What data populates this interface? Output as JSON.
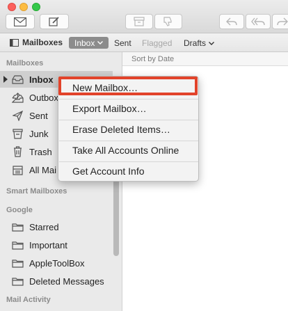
{
  "toolbar": {
    "buttons": [
      "compose-icon",
      "new-message-icon",
      "archive-icon",
      "junk-icon",
      "reply-icon",
      "reply-all-icon",
      "forward-icon"
    ]
  },
  "favorites": {
    "mailboxes_label": "Mailboxes",
    "inbox_label": "Inbox",
    "sent_label": "Sent",
    "flagged_label": "Flagged",
    "drafts_label": "Drafts"
  },
  "sidebar": {
    "section_mailboxes": "Mailboxes",
    "mailboxes": [
      {
        "label": "Inbox",
        "icon": "inbox-icon",
        "selected": true
      },
      {
        "label": "Outbox",
        "icon": "outbox-icon"
      },
      {
        "label": "Sent",
        "icon": "paper-plane-icon"
      },
      {
        "label": "Junk",
        "icon": "junk-bin-icon"
      },
      {
        "label": "Trash",
        "icon": "trash-icon"
      },
      {
        "label": "All Mai",
        "icon": "all-mail-icon"
      }
    ],
    "section_smart": "Smart Mailboxes",
    "section_google": "Google",
    "google": [
      {
        "label": "Starred",
        "icon": "folder-icon"
      },
      {
        "label": "Important",
        "icon": "folder-icon"
      },
      {
        "label": "AppleToolBox",
        "icon": "folder-icon"
      },
      {
        "label": "Deleted Messages",
        "icon": "folder-icon"
      }
    ],
    "section_activity": "Mail Activity"
  },
  "list": {
    "sort_label": "Sort by Date"
  },
  "context_menu": {
    "items": [
      "New Mailbox…",
      "Export Mailbox…",
      "Erase Deleted Items…",
      "Take All Accounts Online",
      "Get Account Info"
    ],
    "highlighted_index": 0,
    "highlight_color": "#e2432a"
  }
}
